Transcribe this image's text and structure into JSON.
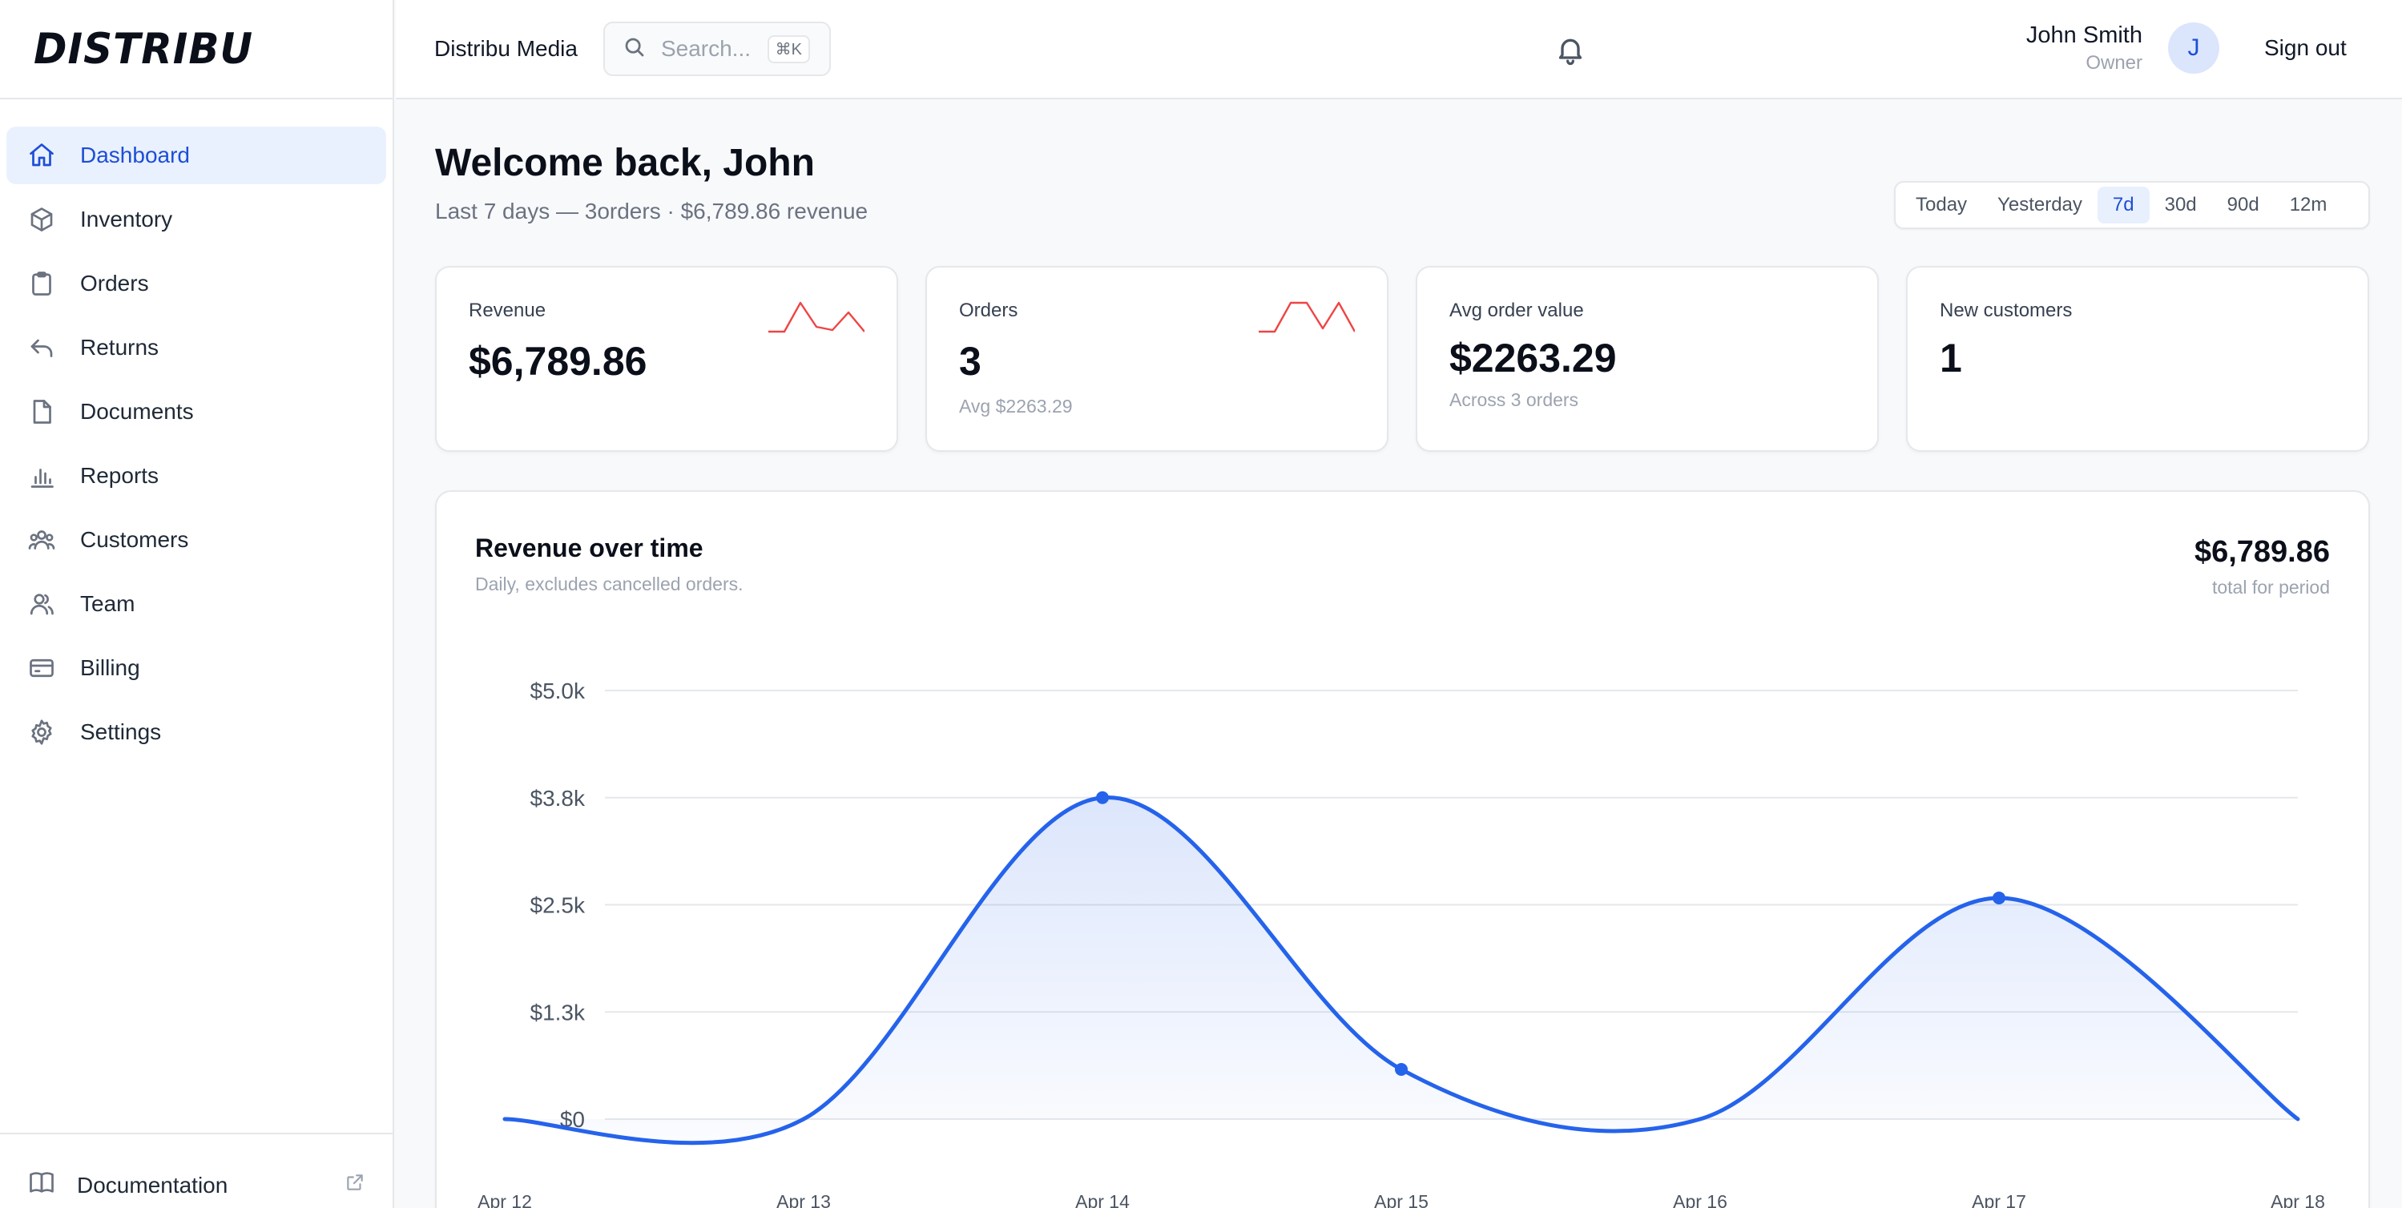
{
  "brand": {
    "logo": "DISTRIBU"
  },
  "sidebar": {
    "items": [
      {
        "label": "Dashboard",
        "icon": "home-icon",
        "active": true
      },
      {
        "label": "Inventory",
        "icon": "box-icon"
      },
      {
        "label": "Orders",
        "icon": "clipboard-icon"
      },
      {
        "label": "Returns",
        "icon": "return-arrow-icon"
      },
      {
        "label": "Documents",
        "icon": "document-icon"
      },
      {
        "label": "Reports",
        "icon": "bar-chart-icon"
      },
      {
        "label": "Customers",
        "icon": "users-icon"
      },
      {
        "label": "Team",
        "icon": "team-icon"
      },
      {
        "label": "Billing",
        "icon": "credit-card-icon"
      },
      {
        "label": "Settings",
        "icon": "gear-icon"
      }
    ],
    "footer": {
      "label": "Documentation",
      "icon": "book-icon",
      "external_icon": "external-link-icon"
    }
  },
  "topbar": {
    "org_name": "Distribu Media",
    "search": {
      "placeholder": "Search...",
      "shortcut": "⌘K"
    },
    "user": {
      "name": "John Smith",
      "role": "Owner",
      "initial": "J"
    },
    "sign_out": "Sign out"
  },
  "header": {
    "welcome": "Welcome back, John",
    "subtitle": "Last 7 days — 3orders · $6,789.86 revenue",
    "ranges": [
      "Today",
      "Yesterday",
      "7d",
      "30d",
      "90d",
      "12m"
    ],
    "active_range": "7d"
  },
  "kpis": [
    {
      "label": "Revenue",
      "value": "$6,789.86",
      "note": ""
    },
    {
      "label": "Orders",
      "value": "3",
      "note": "Avg $2263.29"
    },
    {
      "label": "Avg order value",
      "value": "$2263.29",
      "note": "Across 3 orders"
    },
    {
      "label": "New customers",
      "value": "1",
      "note": ""
    }
  ],
  "chart_card": {
    "title": "Revenue over time",
    "subtitle": "Daily, excludes cancelled orders.",
    "total": "$6,789.86",
    "total_label": "total for period"
  },
  "colors": {
    "accent": "#2563eb",
    "spark": "#ef4444",
    "active_bg": "#eaf1fe"
  },
  "chart_data": {
    "type": "area",
    "x": [
      "Apr 12",
      "Apr 13",
      "Apr 14",
      "Apr 15",
      "Apr 16",
      "Apr 17",
      "Apr 18"
    ],
    "y_points": [
      null,
      null,
      3750,
      580,
      null,
      2580,
      null
    ],
    "series": [
      {
        "values": [
          0,
          0,
          3750,
          580,
          0,
          2580,
          0
        ]
      }
    ],
    "y_ticks": [
      "$0",
      "$1.3k",
      "$2.5k",
      "$3.8k",
      "$5.0k"
    ],
    "ylim": [
      0,
      5000
    ],
    "grid": true
  }
}
